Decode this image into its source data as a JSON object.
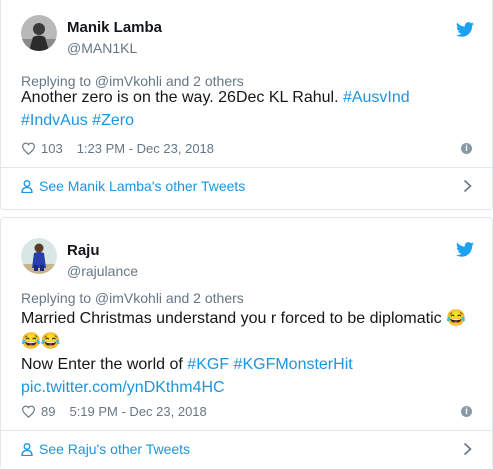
{
  "tweets": [
    {
      "author_name": "Manik Lamba",
      "author_handle": "@MAN1KL",
      "reply_to": "Replying to @imVkohli and 2 others",
      "text_line1": "Another zero is on the way. 26Dec KL Rahul. ",
      "hashtag1": "#AusvInd",
      "hashtag2": "#IndvAus",
      "hashtag3": "#Zero",
      "likes": "103",
      "timestamp": "1:23 PM - Dec 23, 2018",
      "other_tweets_label": "See Manik Lamba's other Tweets"
    },
    {
      "author_name": "Raju",
      "author_handle": "@rajulance",
      "reply_to": "Replying to @imVkohli and 2 others",
      "text_line1": "Married Christmas understand you r forced to be diplomatic ",
      "emoji": "😂",
      "text_line3": "Now Enter the world of ",
      "hashtag1": "#KGF",
      "hashtag2": "#KGFMonsterHit",
      "pic_link": "pic.twitter.com/ynDKthm4HC",
      "likes": "89",
      "timestamp": "5:19 PM - Dec 23, 2018",
      "other_tweets_label": "See Raju's other Tweets"
    }
  ],
  "colors": {
    "link": "#1b95e0",
    "secondary_text": "#657786",
    "primary_text": "#14171a",
    "twitter_blue": "#1da1f2",
    "border": "#e1e8ed"
  },
  "icons": [
    "twitter-bird-icon",
    "heart-icon",
    "info-icon",
    "person-icon",
    "chevron-right-icon"
  ]
}
